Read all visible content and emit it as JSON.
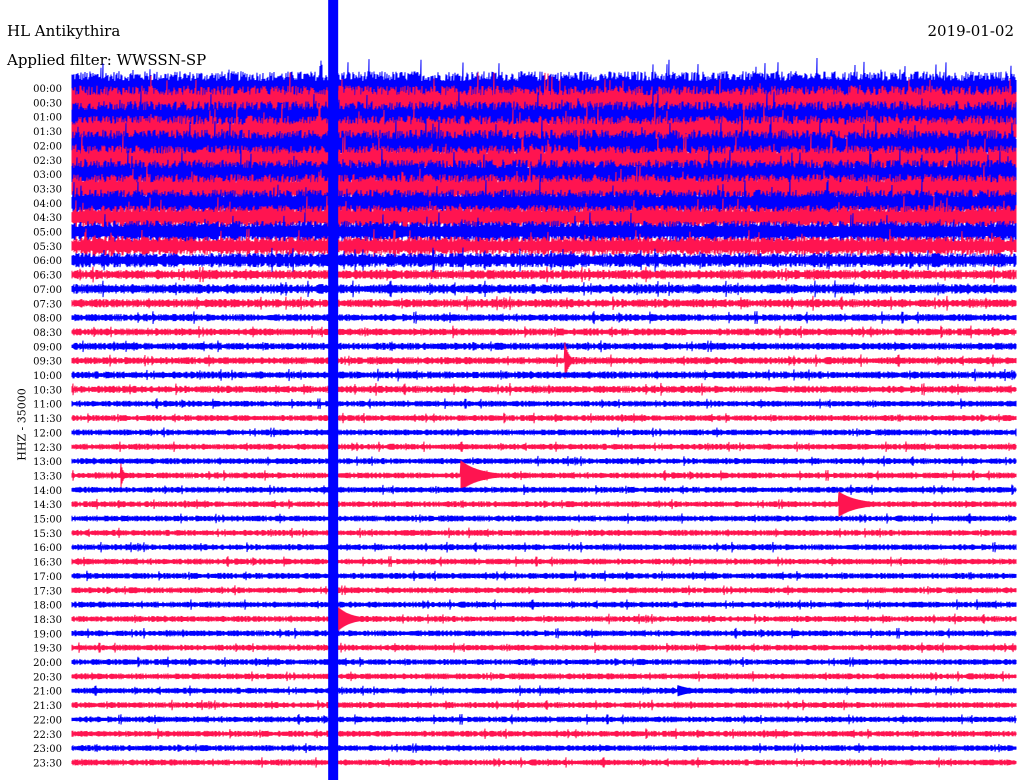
{
  "header": {
    "station": "HL Antikythira",
    "filter": "Applied filter: WWSSN-SP",
    "date": "2019-01-02"
  },
  "chart_data": {
    "type": "line",
    "title": "HL Antikythira",
    "subtitle": "Applied filter: WWSSN-SP",
    "ylabel": "HHZ - 35000",
    "x_range_minutes": [
      0,
      30
    ],
    "colors": [
      "#0000ff",
      "#ff1450"
    ],
    "rows": [
      "00:00",
      "00:30",
      "01:00",
      "01:30",
      "02:00",
      "02:30",
      "03:00",
      "03:30",
      "04:00",
      "04:30",
      "05:00",
      "05:30",
      "06:00",
      "06:30",
      "07:00",
      "07:30",
      "08:00",
      "08:30",
      "09:00",
      "09:30",
      "10:00",
      "10:30",
      "11:00",
      "11:30",
      "12:00",
      "12:30",
      "13:00",
      "13:30",
      "14:00",
      "14:30",
      "15:00",
      "15:30",
      "16:00",
      "16:30",
      "17:00",
      "17:30",
      "18:00",
      "18:30",
      "19:00",
      "19:30",
      "20:00",
      "20:30",
      "21:00",
      "21:30",
      "22:00",
      "22:30",
      "23:00",
      "23:30"
    ],
    "noise_level": [
      14,
      14,
      13,
      13,
      13,
      12,
      12,
      12,
      11,
      10,
      9,
      8,
      6,
      4,
      4,
      3.5,
      3,
      3,
      3,
      3,
      3,
      3,
      2.5,
      2.5,
      2.5,
      2.5,
      2.5,
      2.5,
      2.5,
      2.5,
      2.5,
      2.5,
      2.5,
      2.5,
      2.5,
      2.5,
      2.5,
      2.5,
      2.5,
      2.5,
      2.5,
      2.5,
      2.5,
      2.5,
      2.5,
      2.5,
      2.5,
      2.5
    ],
    "events": [
      {
        "row": "09:30",
        "minute": 15.7,
        "amplitude": 14,
        "duration": 0.3
      },
      {
        "row": "13:30",
        "minute": 12.4,
        "amplitude": 14,
        "duration": 1.5
      },
      {
        "row": "13:30",
        "minute": 1.6,
        "amplitude": 7,
        "duration": 0.2
      },
      {
        "row": "14:30",
        "minute": 24.4,
        "amplitude": 12,
        "duration": 1.5
      },
      {
        "row": "18:30",
        "minute": 8.4,
        "amplitude": 14,
        "duration": 1.0
      },
      {
        "row": "21:00",
        "minute": 19.3,
        "amplitude": 5,
        "duration": 1.2
      }
    ],
    "clipped_spike_minute": 8.3
  }
}
